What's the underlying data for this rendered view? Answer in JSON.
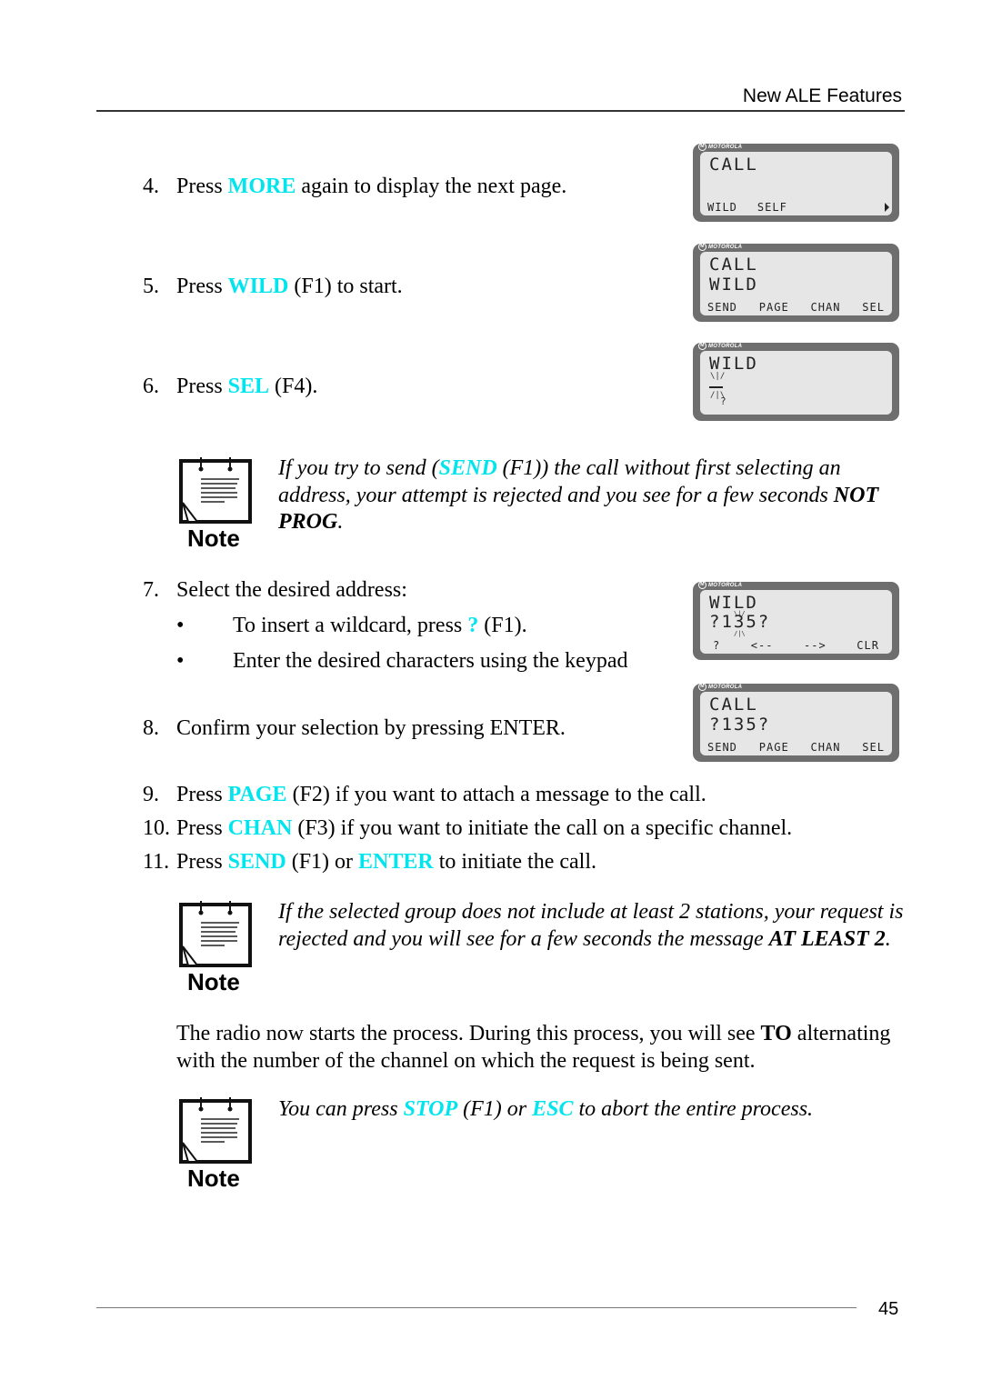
{
  "header": {
    "title": "New ALE Features"
  },
  "footer": {
    "page_number": "45"
  },
  "colors": {
    "keyword": "#00e5ee",
    "lcd_bezel": "#6e6e6e",
    "lcd_screen": "#e6e6e6"
  },
  "steps": [
    {
      "num": "4.",
      "pre": "Press ",
      "kw": "MORE",
      "post": " again to display the next page."
    },
    {
      "num": "5.",
      "pre": "Press ",
      "kw": "WILD",
      "post": " (F1) to start."
    },
    {
      "num": "6.",
      "pre": "Press ",
      "kw": "SEL",
      "post": " (F4)."
    },
    {
      "num": "7.",
      "text": "Select the desired address:"
    },
    {
      "num": "8.",
      "text": "Confirm your selection by pressing ENTER."
    },
    {
      "num": "9.",
      "pre": "Press ",
      "kw": "PAGE",
      "post": " (F2) if you want to attach a message to the call."
    },
    {
      "num": "10.",
      "pre": "Press ",
      "kw": "CHAN",
      "post": " (F3) if you want to initiate the call on a specific channel."
    },
    {
      "num": "11.",
      "pre": "Press ",
      "kw": "SEND",
      "mid": " (F1) or ",
      "kw2": "ENTER",
      "post": " to initiate the call."
    }
  ],
  "bullets": [
    {
      "pre": "To insert a wildcard, press ",
      "kw": "?",
      "post": " (F1)."
    },
    {
      "text": "Enter the desired characters using the keypad"
    }
  ],
  "notes": [
    {
      "label": "Note",
      "pre": "If you try to send (",
      "kw": "SEND",
      "post": " (F1)) the call without first selecting an address, your attempt is rejected and you see for a few seconds ",
      "bold": "NOT PROG",
      "end": "."
    },
    {
      "label": "Note",
      "pre": "If the selected group does not include at least 2 stations, your request is rejected and you will see for a few seconds the message ",
      "bold": "AT LEAST 2",
      "end": "."
    },
    {
      "label": "Note",
      "pre": "You can press ",
      "kw": "STOP",
      "mid": " (F1) or ",
      "kw2": "ESC",
      "post": " to abort the entire process."
    }
  ],
  "paragraph": {
    "pre": "The radio now starts the process. During this process, you will see ",
    "bold": "TO",
    "post": " alternating with the number of the channel on which the request is being sent."
  },
  "lcd_brand": "MOTOROLA",
  "lcds": [
    {
      "line1": "CALL",
      "line2": "",
      "softkeys": [
        "WILD",
        "SELF"
      ],
      "more_arrow": true
    },
    {
      "line1": "CALL",
      "line2": "WILD",
      "softkeys": [
        "SEND",
        "PAGE",
        "CHAN",
        "SEL"
      ]
    },
    {
      "line1": "WILD",
      "line2": "",
      "softkeys": [],
      "cursor_char": "?"
    },
    {
      "line1": "WILD",
      "line2": "?135?",
      "softkeys": [
        "?",
        "<--",
        "-->",
        "CLR"
      ]
    },
    {
      "line1": "CALL",
      "line2": "?135?",
      "softkeys": [
        "SEND",
        "PAGE",
        "CHAN",
        "SEL"
      ]
    }
  ]
}
